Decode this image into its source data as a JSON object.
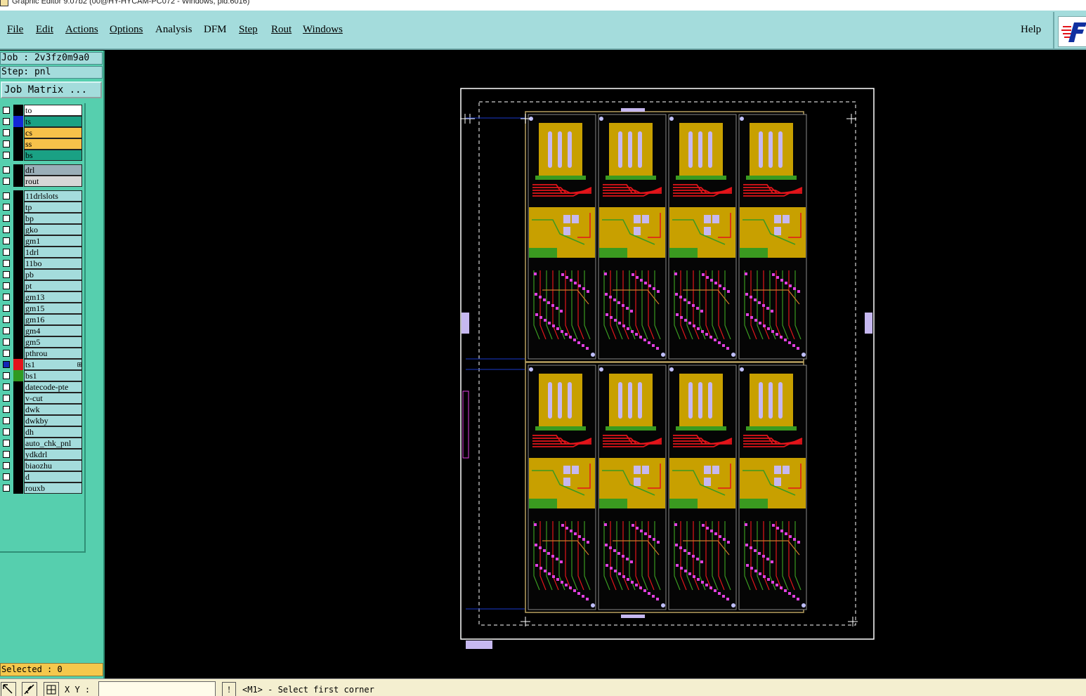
{
  "window": {
    "title": "Graphic Editor 9.07b2 (00@HY-HYCAM-PC072 - Windows, pid:6016)"
  },
  "menubar": {
    "items": [
      {
        "id": "file",
        "label": "File"
      },
      {
        "id": "edit",
        "label": "Edit"
      },
      {
        "id": "actions",
        "label": "Actions"
      },
      {
        "id": "options",
        "label": "Options"
      },
      {
        "id": "analysis",
        "label": "Analysis"
      },
      {
        "id": "dfm",
        "label": "DFM"
      },
      {
        "id": "step",
        "label": "Step"
      },
      {
        "id": "rout",
        "label": "Rout"
      },
      {
        "id": "windows",
        "label": "Windows"
      }
    ],
    "help_label": "Help"
  },
  "left": {
    "job": "Job : 2v3fz0m9a0",
    "step": "Step: pnl",
    "job_matrix_label": "Job Matrix ...",
    "selected": "Selected : 0",
    "layers": [
      {
        "name": "to",
        "bg": "#ffffff",
        "swatch": "#000000",
        "checked": false
      },
      {
        "name": "ts",
        "bg": "#1aa184",
        "swatch": "#1326d6",
        "checked": false
      },
      {
        "name": "cs",
        "bg": "#f7c24a",
        "swatch": "#000000",
        "checked": false
      },
      {
        "name": "ss",
        "bg": "#f7c24a",
        "swatch": "#000000",
        "checked": false
      },
      {
        "name": "bs",
        "bg": "#1aa184",
        "swatch": "#000000",
        "checked": false
      },
      {
        "name": "drl",
        "bg": "#9aaeb8",
        "swatch": "#000000",
        "checked": false
      },
      {
        "name": "rout",
        "bg": "#d7d7d7",
        "swatch": "#000000",
        "checked": false
      },
      {
        "name": "11drlslots",
        "bg": "#a4dcdc",
        "swatch": "#000000",
        "checked": false
      },
      {
        "name": "tp",
        "bg": "#a4dcdc",
        "swatch": "#000000",
        "checked": false
      },
      {
        "name": "bp",
        "bg": "#a4dcdc",
        "swatch": "#000000",
        "checked": false
      },
      {
        "name": "gko",
        "bg": "#a4dcdc",
        "swatch": "#000000",
        "checked": false
      },
      {
        "name": "gm1",
        "bg": "#a4dcdc",
        "swatch": "#000000",
        "checked": false
      },
      {
        "name": "1drl",
        "bg": "#a4dcdc",
        "swatch": "#000000",
        "checked": false
      },
      {
        "name": "11bo",
        "bg": "#a4dcdc",
        "swatch": "#000000",
        "checked": false
      },
      {
        "name": "pb",
        "bg": "#a4dcdc",
        "swatch": "#000000",
        "checked": false
      },
      {
        "name": "pt",
        "bg": "#a4dcdc",
        "swatch": "#000000",
        "checked": false
      },
      {
        "name": "gm13",
        "bg": "#a4dcdc",
        "swatch": "#000000",
        "checked": false
      },
      {
        "name": "gm15",
        "bg": "#a4dcdc",
        "swatch": "#000000",
        "checked": false
      },
      {
        "name": "gm16",
        "bg": "#a4dcdc",
        "swatch": "#000000",
        "checked": false
      },
      {
        "name": "gm4",
        "bg": "#a4dcdc",
        "swatch": "#000000",
        "checked": false
      },
      {
        "name": "gm5",
        "bg": "#a4dcdc",
        "swatch": "#000000",
        "checked": false
      },
      {
        "name": "pthrou",
        "bg": "#a4dcdc",
        "swatch": "#000000",
        "checked": false
      },
      {
        "name": "ts1",
        "bg": "#a4dcdc",
        "swatch": "#e2141a",
        "checked": true,
        "mark": "⊞"
      },
      {
        "name": "bs1",
        "bg": "#a4dcdc",
        "swatch": "#2f9a22",
        "checked": false
      },
      {
        "name": "datecode-pte",
        "bg": "#a4dcdc",
        "swatch": "#000000",
        "checked": false
      },
      {
        "name": "v-cut",
        "bg": "#a4dcdc",
        "swatch": "#000000",
        "checked": false
      },
      {
        "name": "dwk",
        "bg": "#a4dcdc",
        "swatch": "#000000",
        "checked": false
      },
      {
        "name": "dwkby",
        "bg": "#a4dcdc",
        "swatch": "#000000",
        "checked": false
      },
      {
        "name": "dh",
        "bg": "#a4dcdc",
        "swatch": "#000000",
        "checked": false
      },
      {
        "name": "auto_chk_pnl",
        "bg": "#a4dcdc",
        "swatch": "#000000",
        "checked": false
      },
      {
        "name": "ydkdrl",
        "bg": "#a4dcdc",
        "swatch": "#000000",
        "checked": false
      },
      {
        "name": "biaozhu",
        "bg": "#a4dcdc",
        "swatch": "#000000",
        "checked": false
      },
      {
        "name": "d",
        "bg": "#a4dcdc",
        "swatch": "#000000",
        "checked": false
      },
      {
        "name": "rouxb",
        "bg": "#a4dcdc",
        "swatch": "#000000",
        "checked": false
      }
    ]
  },
  "status": {
    "xy_label": "X Y :",
    "xy_value": "",
    "warn_label": "!",
    "prompt": "<M1> - Select first corner"
  },
  "colors": {
    "panel_teal": "#56cfae",
    "menu_cyan": "#a4dcdc",
    "selected_bg": "#f5c84c",
    "board_gold": "#c8a000",
    "trace_red": "#e2141a",
    "pad_magenta": "#e040e0",
    "ground_green": "#3a9a20",
    "slot_lavender": "#c6b8f0"
  },
  "canvas": {
    "panel_layout": {
      "rows": 2,
      "cols": 4
    }
  }
}
